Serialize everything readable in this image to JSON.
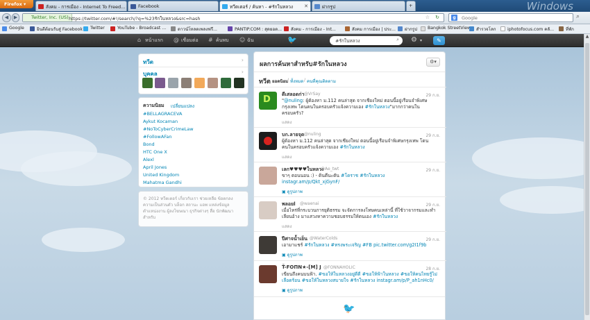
{
  "browser": {
    "firefox_label": "Firefox",
    "tabs": [
      {
        "label": "สังคม - การเมือง - Internet To Freed...",
        "active": false,
        "icon_color": "#cc2222",
        "icon": "if-icon"
      },
      {
        "label": "Facebook",
        "active": false,
        "icon_color": "#3b5998",
        "icon": "facebook-icon"
      },
      {
        "label": "ทวีตเตอร์ / ค้นหา - #รักในหลวง",
        "active": true,
        "icon_color": "#33aaee",
        "icon": "twitter-icon"
      },
      {
        "label": "ฝากรูป",
        "active": false,
        "icon_color": "#5588cc",
        "icon": "page-icon"
      }
    ],
    "new_tab": "+",
    "windows_label": "Windows",
    "url_site": "Twitter, Inc. (US)",
    "url": "https://twitter.com/#!/search/?q=%23รักในหลวง&src=hash",
    "search_engine": "Google",
    "search_placeholder": "Google"
  },
  "bookmarks": [
    {
      "label": "Google",
      "color": "#4a8ae8"
    },
    {
      "label": "ยินดีต้อนรับสู่ Facebook",
      "color": "#3b5998"
    },
    {
      "label": "Twitter",
      "color": "#33aaee"
    },
    {
      "label": "YouTube - Broadcast ...",
      "color": "#cc2222"
    },
    {
      "label": "ดาวน์โหลดเพลงฟรี...",
      "color": "#888888"
    },
    {
      "label": "PANTIP.COM : สุดยอด...",
      "color": "#6644aa"
    },
    {
      "label": "สังคม - การเมือง - Int...",
      "color": "#cc2222"
    },
    {
      "label": "สังคม การเมือง | ประ...",
      "color": "#aa6633"
    },
    {
      "label": "ฝากรูป",
      "color": "#5588cc"
    },
    {
      "label": "Bangkok StreetView",
      "color": "#dddddd"
    },
    {
      "label": "สำรวจโลก",
      "color": "#4488cc"
    },
    {
      "label": "iphotofocus.com คลั...",
      "color": "#ffffff"
    },
    {
      "label": "ที่พัก",
      "color": "#886644"
    }
  ],
  "twitter_nav": {
    "home": "หน้าแรก",
    "connect": "เชื่อมต่อ",
    "discover": "ค้นพบ",
    "me": "ฉัน",
    "search_value": "#รักในหลวง"
  },
  "sidebar": {
    "tweets_link": "ทวีต",
    "people_link": "บุคคล",
    "people_avatars": [
      "#3a6e2c",
      "#7a5a8e",
      "#9aa4ab",
      "#8c7f76",
      "#f2a95a",
      "#b59282",
      "#2f6b3b",
      "#223322"
    ],
    "trends_title": "ความนิยม",
    "trends_change": "เปลี่ยนแปลง",
    "trends": [
      "#BELLAGRACEVA",
      "Aykut Kocaman",
      "#NoToCyberCrimeLaw",
      "#FollowAFan",
      "Bond",
      "HTC One X",
      "Alexl",
      "April Jones",
      "United Kingdom",
      "Mahatma Gandhi"
    ],
    "footer": "© 2012 ทวีตเตอร์ เกี่ยวกับเรา ช่วยเหลือ ข้อตกลง ความเป็นส่วนตัว บล็อก สถานะ แอพ แหล่งข้อมูล ตำแหน่งงาน ผู้ลงโฆษณา ธุรกิจต่างๆ สื่อ นักพัฒนา สำหรับ"
  },
  "results": {
    "title": "ผลการค้นหาสำหรับ#รักในหลวง",
    "tab_tweets": "ทวีต",
    "filter_top": "ยอดนิยม",
    "filter_all": "ทั้งหมด",
    "filter_people": "คนที่คุณติดตาม",
    "sep": "/",
    "tweets": [
      {
        "name": "ดีเสลอดก่า",
        "handle": "@VrSay",
        "time": "29 ก.ย.",
        "avatar_color": "#2a8a1e",
        "avatar_icon": "avatar-green-logo-icon",
        "text": "\"@nuling: ผู้ต้องหา ม.112 คนล่าสุด จากเชียงใหม่ ตอนนี้อยู่เรือนจำพิเศษกรุงเทพ โดนคนในครอบครัวแจ้งความเอง #รักในหลวง\"มากกว่าคนในครอบครัว?",
        "meta": "แสดง",
        "meta_blue": false
      },
      {
        "name": "บก.ลายจุด",
        "handle": "@nuling",
        "time": "29 ก.ย.",
        "avatar_color": "#1c1c1c",
        "avatar_icon": "avatar-red-spot-icon",
        "text": "ผู้ต้องหา ม.112 คนล่าสุด จากเชียงใหม่ ตอนนี้อยู่เรือนจำพิเศษกรุงเทพ โดนคนในครอบครัวแจ้งความเอง #รักในหลวง",
        "meta": "แสดง",
        "meta_blue": false
      },
      {
        "name": "เลก♥♥♥♥ในหลวง",
        "handle": "@Ae_twt",
        "time": "29 ก.ย.",
        "avatar_color": "#c9a79a",
        "avatar_icon": "avatar-photo-icon",
        "text": "ขาๆ ตอนนอน :) - ดินตีนะตัน #โดราช #รักในหลวง instagr.am/p/Qkt_xjGynF/",
        "meta": "ดูรูปภาพ",
        "meta_blue": true
      },
      {
        "name": "พลอยl",
        "handle": "@waenai",
        "time": "29 ก.ย.",
        "avatar_color": "#d8ccc4",
        "avatar_icon": "avatar-photo-icon",
        "text": "เมื่อไหร่ที่กระบวนการยุติธรรม จะจัดการลงโทษคนเหล่านี้ ที่ใช้วาจากรมและทำเลียนอ้าง มาแสวงหาความชอบธรรมให้ตนเอง #รักในหลวง",
        "meta": "แสดง",
        "meta_blue": false
      },
      {
        "name": "ปีศาจน้ำเย็น",
        "handle": "@WaterColds",
        "time": "29 ก.ย.",
        "avatar_color": "#3e3a36",
        "avatar_icon": "avatar-photo-icon",
        "text": "เอามาแชร์ #รักในหลวง #ทรงพระเจริญ #FB pic.twitter.com/g2I1f9b",
        "meta": "ดูรูปภาพ",
        "meta_blue": true
      },
      {
        "name": "Ť-FOПΝ★-[M] J",
        "handle": "@FONNAHOLIC",
        "time": "28 ก.ย.",
        "avatar_color": "#6b3a2e",
        "avatar_icon": "avatar-photo-icon",
        "text": "เขียนถึงคนบนฟ้า. #ขอให้ในหลวงอยู่ดีดี #ขอให้ฟ้าในหลวง #ขอให้คนไทยรู้ไม่เลือดร้อน #ขอให้ในหลวงสบายใจ #รักในหลวง instagr.am/p/P_ah1nHc0/",
        "meta": "ดูรูปภาพ",
        "meta_blue": true
      }
    ]
  },
  "colors": {
    "link": "#0084b4",
    "twitter_bar": "#333333",
    "compose": "#2f8fcf"
  }
}
